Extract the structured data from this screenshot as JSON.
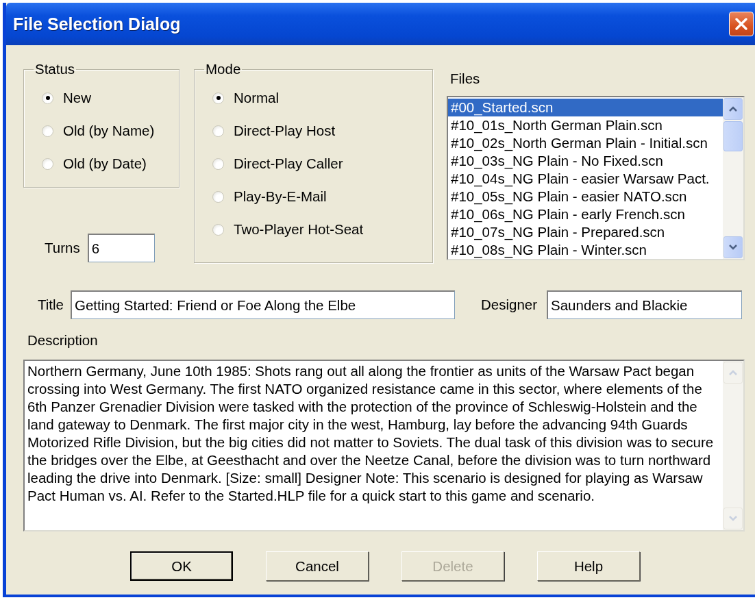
{
  "window": {
    "title": "File Selection Dialog"
  },
  "status": {
    "label": "Status",
    "options": [
      {
        "label": "New",
        "selected": true
      },
      {
        "label": "Old (by Name)",
        "selected": false
      },
      {
        "label": "Old (by Date)",
        "selected": false
      }
    ]
  },
  "mode": {
    "label": "Mode",
    "options": [
      {
        "label": "Normal",
        "selected": true
      },
      {
        "label": "Direct-Play Host",
        "selected": false
      },
      {
        "label": "Direct-Play Caller",
        "selected": false
      },
      {
        "label": "Play-By-E-Mail",
        "selected": false
      },
      {
        "label": "Two-Player Hot-Seat",
        "selected": false
      }
    ]
  },
  "turns": {
    "label": "Turns",
    "value": "6"
  },
  "files": {
    "label": "Files",
    "items": [
      {
        "name": "#00_Started.scn",
        "selected": true
      },
      {
        "name": "#10_01s_North German Plain.scn",
        "selected": false
      },
      {
        "name": "#10_02s_North German Plain - Initial.scn",
        "selected": false
      },
      {
        "name": "#10_03s_NG Plain - No Fixed.scn",
        "selected": false
      },
      {
        "name": "#10_04s_NG Plain - easier Warsaw Pact.",
        "selected": false
      },
      {
        "name": "#10_05s_NG Plain - easier NATO.scn",
        "selected": false
      },
      {
        "name": "#10_06s_NG Plain - early French.scn",
        "selected": false
      },
      {
        "name": "#10_07s_NG Plain - Prepared.scn",
        "selected": false
      },
      {
        "name": "#10_08s_NG Plain - Winter.scn",
        "selected": false
      }
    ]
  },
  "title": {
    "label": "Title",
    "value": "Getting Started: Friend or Foe Along the Elbe"
  },
  "designer": {
    "label": "Designer",
    "value": "Saunders and Blackie"
  },
  "description": {
    "label": "Description",
    "value": "Northern Germany, June 10th 1985: Shots rang out all along the frontier as units of the Warsaw Pact began crossing into West Germany. The first NATO organized resistance came in this sector, where elements of the 6th Panzer Grenadier Division were tasked with the protection of the province of Schleswig-Holstein and the land gateway to Denmark. The first major city in the west, Hamburg, lay before the advancing 94th Guards Motorized Rifle Division, but the big cities did not matter to Soviets. The dual task of this division was to secure the bridges over the Elbe, at Geesthacht and over the Neetze Canal, before the division was to turn northward leading the drive into Denmark. [Size: small] Designer Note: This scenario is designed for playing as Warsaw Pact Human vs. AI. Refer to the Started.HLP file for a quick start to this game and scenario."
  },
  "buttons": [
    {
      "label": "OK",
      "default": true,
      "disabled": false
    },
    {
      "label": "Cancel",
      "default": false,
      "disabled": false
    },
    {
      "label": "Delete",
      "default": false,
      "disabled": true
    },
    {
      "label": "Help",
      "default": false,
      "disabled": false
    }
  ]
}
